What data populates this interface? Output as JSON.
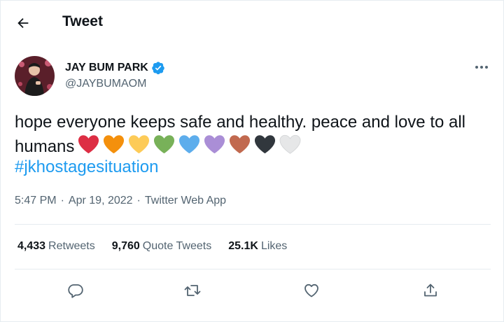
{
  "header": {
    "title": "Tweet"
  },
  "author": {
    "name": "JAY BUM PARK",
    "handle": "@JAYBUMAOM",
    "verified": true
  },
  "tweet": {
    "text": "hope everyone keeps safe and healthy. peace and love to all humans",
    "hearts": [
      "#dd2e44",
      "#f4900c",
      "#fdcb58",
      "#78b159",
      "#5dadec",
      "#aa8ed6",
      "#c1694f",
      "#31373d",
      "#e6e7e8"
    ],
    "hashtag": "#jkhostagesituation"
  },
  "meta": {
    "time": "5:47 PM",
    "date": "Apr 19, 2022",
    "source": "Twitter Web App",
    "separator": "·"
  },
  "stats": {
    "retweets_count": "4,433",
    "retweets_label": "Retweets",
    "quotes_count": "9,760",
    "quotes_label": "Quote Tweets",
    "likes_count": "25.1K",
    "likes_label": "Likes"
  },
  "colors": {
    "accent": "#1d9bf0",
    "text": "#0f1419",
    "secondary": "#536471",
    "divider": "#e6ecf0"
  },
  "icons": [
    "back-arrow-icon",
    "verified-badge-icon",
    "more-icon",
    "reply-icon",
    "retweet-icon",
    "like-icon",
    "share-icon"
  ]
}
